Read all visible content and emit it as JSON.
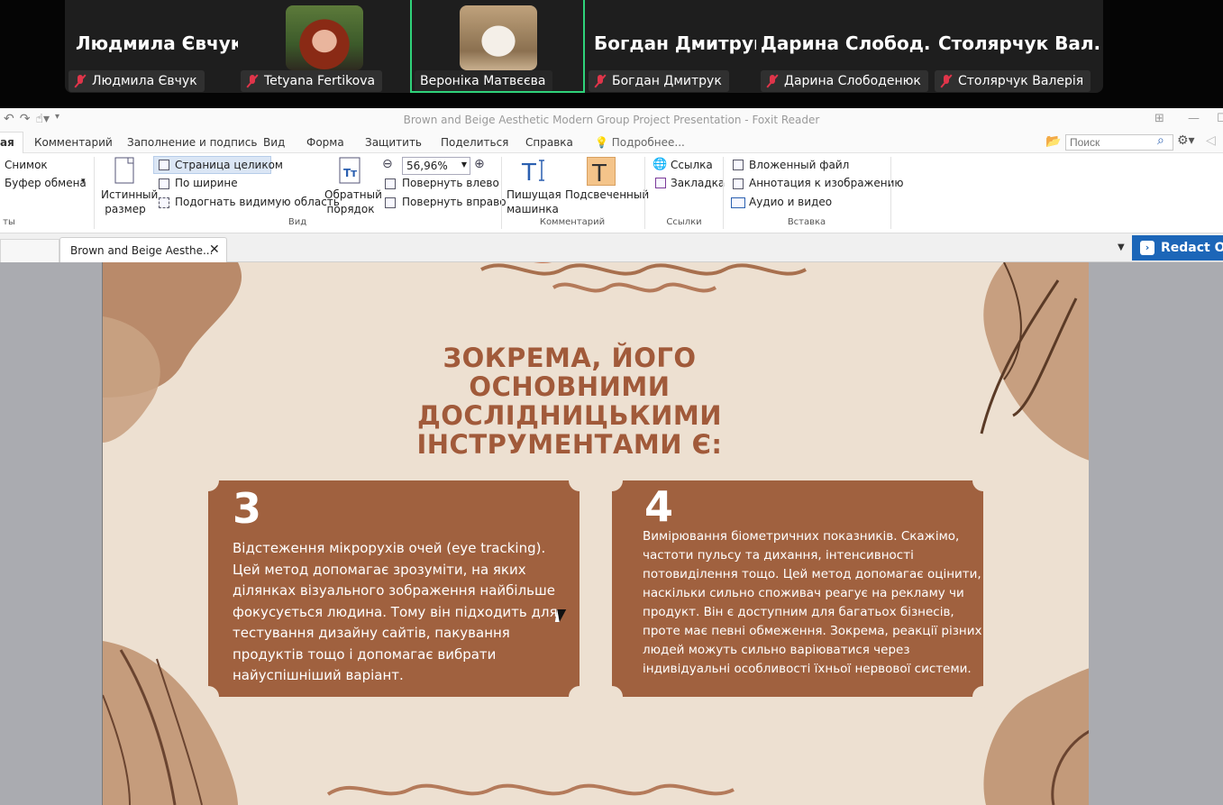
{
  "zoom": {
    "participants": [
      {
        "big_name": "Людмила Євчук",
        "label": "Людмила Євчук",
        "has_video": false
      },
      {
        "big_name": "",
        "label": "Tetyana Fertikova",
        "has_video": true
      },
      {
        "big_name": "",
        "label": "Вероніка Матвєєва",
        "has_video": true
      },
      {
        "big_name": "Богдан Дмитрук",
        "label": "Богдан Дмитрук",
        "has_video": false
      },
      {
        "big_name": "Дарина  Слобод...",
        "label": "Дарина Слободенюк",
        "has_video": false
      },
      {
        "big_name": "Столярчук  Вал...",
        "label": "Столярчук Валерія",
        "has_video": false
      }
    ]
  },
  "window": {
    "title": "Brown and Beige Aesthetic Modern Group Project Presentation - Foxit Reader"
  },
  "menu": {
    "items": [
      "ая",
      "Комментарий",
      "Заполнение и подпись",
      "Вид",
      "Форма",
      "Защитить",
      "Поделиться",
      "Справка",
      "Подробнее..."
    ],
    "search_placeholder": "Поиск"
  },
  "ribbon": {
    "snapshot": "Снимок",
    "clipboard": "Буфер обмена",
    "tools_group_fragment": "ты",
    "actual_size_line1": "Истинный",
    "actual_size_line2": "размер",
    "fit_page": "Страница целиком",
    "fit_width": "По ширине",
    "fit_visible": "Подогнать видимую область",
    "reverse_line1": "Обратный",
    "reverse_line2": "порядок",
    "zoom_value": "56,96%",
    "rotate_left": "Повернуть влево",
    "rotate_right": "Повернуть вправо",
    "view_group": "Вид",
    "typewriter_line1": "Пишущая",
    "typewriter_line2": "машинка",
    "highlight": "Подсвеченный",
    "comment_group": "Комментарий",
    "link": "Ссылка",
    "bookmark": "Закладка",
    "links_group": "Ссылки",
    "attached_file": "Вложенный файл",
    "image_annotation": "Аннотация к изображению",
    "audio_video": "Аудио и видео",
    "insert_group": "Вставка"
  },
  "tabs": {
    "document_tab": "Brown and Beige Aesthe...",
    "redact": "Redact Or"
  },
  "slide": {
    "title": "ЗОКРЕМА, ЙОГО ОСНОВНИМИ ДОСЛІДНИЦЬКИМИ ІНСТРУМЕНТАМИ Є:",
    "cards": [
      {
        "number": "3",
        "text": "Відстеження мікрорухів очей (eye tracking). Цей метод допомагає зрозуміти, на яких ділянках візуального зображення найбільше фокусується людина. Тому він підходить для тестування дизайну сайтів, пакування продуктів тощо і допомагає вибрати найуспішніший варіант."
      },
      {
        "number": "4",
        "text": "Вимірювання біометричних показників. Скажімо, частоти пульсу та дихання, інтенсивності потовиділення тощо. Цей метод допомагає оцінити, наскільки сильно споживач реагує на рекламу чи продукт. Він є доступним для багатьох бізнесів, проте має певні обмеження. Зокрема, реакції різних людей можуть сильно варіюватися через індивідуальні особливості їхньої нервової системи."
      }
    ]
  },
  "colors": {
    "slide_bg": "#ede0d1",
    "card": "#a0613f",
    "title": "#a15a3a",
    "active_speaker": "#2fd27a",
    "redact": "#1c66b8"
  }
}
